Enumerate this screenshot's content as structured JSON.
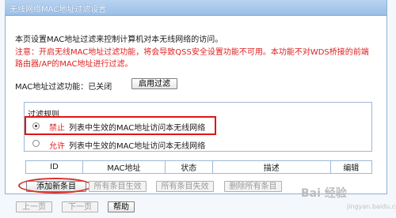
{
  "window": {
    "title": "无线网络MAC地址过滤设置"
  },
  "intro": {
    "line1": "本页设置MAC地址过滤来控制计算机对本无线网络的访问。",
    "note1": "注意：开启无线MAC地址过滤功能，将会导致QSS安全设置功能不可用。本功能不对WDS桥接的前端",
    "note2": "路由器/AP的MAC地址进行过滤。"
  },
  "status": {
    "label": "MAC地址过滤功能：已关闭",
    "button": "启用过滤"
  },
  "rules": {
    "title": "过滤规则",
    "options": [
      {
        "label": "禁止",
        "desc": "列表中生效的MAC地址访问本无线网络",
        "checked": true
      },
      {
        "label": "允许",
        "desc": "列表中生效的MAC地址访问本无线网络",
        "checked": false
      }
    ]
  },
  "table": {
    "headers": [
      "ID",
      "MAC地址",
      "状态",
      "描述",
      "编辑"
    ]
  },
  "actions": {
    "add": "添加新条目",
    "enable_all": "所有条目生效",
    "disable_all": "所有条目失效",
    "delete_all": "删除所有条目"
  },
  "nav": {
    "prev": "上一页",
    "next": "下一页",
    "help": "帮助"
  },
  "watermark": {
    "main": "Bai 经验",
    "sub": "jingyan.baidu.com"
  }
}
